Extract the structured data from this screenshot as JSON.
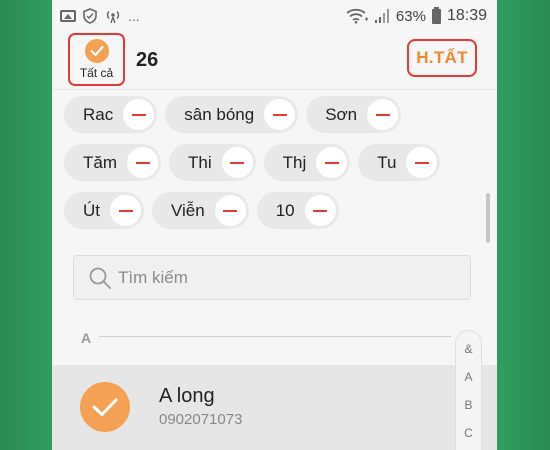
{
  "status_bar": {
    "left_more": "...",
    "battery_percent": "63%",
    "time": "18:39"
  },
  "header": {
    "select_all_label": "Tất cả",
    "selected_count": "26",
    "done_label": "H.TẤT"
  },
  "chips": [
    [
      "Rac",
      "sân bóng",
      "Sơn"
    ],
    [
      "Tăm",
      "Thi",
      "Thj",
      "Tu"
    ],
    [
      "Út",
      "Viễn",
      "10"
    ]
  ],
  "search": {
    "placeholder": "Tìm kiếm"
  },
  "section": {
    "letter": "A"
  },
  "contact": {
    "name": "A long",
    "phone": "0902071073"
  },
  "index": [
    "&",
    "A",
    "B",
    "C"
  ],
  "colors": {
    "accent_orange": "#f4a155",
    "highlight_red": "#e53935",
    "remove_red": "#e53935"
  }
}
